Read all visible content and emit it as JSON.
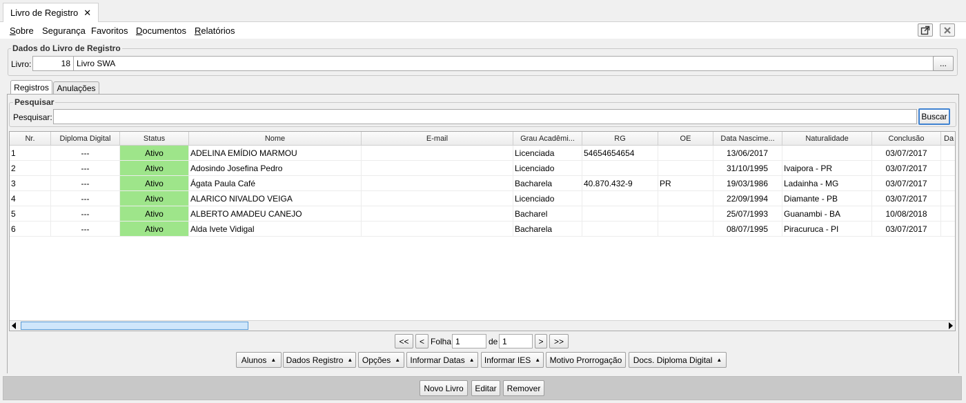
{
  "doc_tab": {
    "label": "Livro de Registro",
    "close": "✕"
  },
  "menu": {
    "items": [
      {
        "pre": "",
        "u": "S",
        "post": "obre"
      },
      {
        "pre": "",
        "u": "",
        "post": "Segurança"
      },
      {
        "pre": "",
        "u": "",
        "post": "Favoritos"
      },
      {
        "pre": "",
        "u": "D",
        "post": "ocumentos"
      },
      {
        "pre": "",
        "u": "R",
        "post": "elatórios"
      }
    ]
  },
  "livro_group": {
    "legend": "Dados do Livro de Registro",
    "label": "Livro:",
    "number": "18",
    "name": "Livro SWA",
    "browse": "..."
  },
  "tabs": [
    "Registros",
    "Anulações"
  ],
  "search": {
    "legend": "Pesquisar",
    "label": "Pesquisar:",
    "value": "",
    "button": "Buscar"
  },
  "table": {
    "columns": [
      "Nr.",
      "Diploma Digital",
      "Status",
      "Nome",
      "E-mail",
      "Grau Acadêmi...",
      "RG",
      "OE",
      "Data Nascime...",
      "Naturalidade",
      "Conclusão",
      "Da"
    ],
    "rows": [
      [
        "1",
        "---",
        "Ativo",
        "ADELINA EMÍDIO MARMOU",
        "",
        "Licenciada",
        "54654654654",
        "",
        "13/06/2017",
        "",
        "03/07/2017"
      ],
      [
        "2",
        "---",
        "Ativo",
        "Adosindo Josefina Pedro",
        "",
        "Licenciado",
        "",
        "",
        "31/10/1995",
        "Ivaipora - PR",
        "03/07/2017"
      ],
      [
        "3",
        "---",
        "Ativo",
        "Ágata Paula Café",
        "",
        "Bacharela",
        "40.870.432-9",
        "PR",
        "19/03/1986",
        "Ladainha - MG",
        "03/07/2017"
      ],
      [
        "4",
        "---",
        "Ativo",
        "ALARICO NIVALDO VEIGA",
        "",
        "Licenciado",
        "",
        "",
        "22/09/1994",
        "Diamante - PB",
        "03/07/2017"
      ],
      [
        "5",
        "---",
        "Ativo",
        "ALBERTO AMADEU CANEJO",
        "",
        "Bacharel",
        "",
        "",
        "25/07/1993",
        "Guanambi - BA",
        "10/08/2018"
      ],
      [
        "6",
        "---",
        "Ativo",
        "Alda Ivete Vidigal",
        "",
        "Bacharela",
        "",
        "",
        "08/07/1995",
        "Piracuruca - PI",
        "03/07/2017"
      ]
    ]
  },
  "pager": {
    "first": "<<",
    "prev": "<",
    "folha_label": "Folha",
    "page": "1",
    "de_label": "de",
    "total": "1",
    "next": ">",
    "last": ">>"
  },
  "actions": [
    "Alunos",
    "Dados Registro",
    "Opções",
    "Informar Datas",
    "Informar IES",
    "Motivo Prorrogação",
    "Docs. Diploma Digital"
  ],
  "footer": {
    "new": "Novo Livro",
    "edit": "Editar",
    "remove": "Remover"
  },
  "colors": {
    "status_active": "#9ee58a",
    "scroll_thumb": "#cfe6fb"
  }
}
